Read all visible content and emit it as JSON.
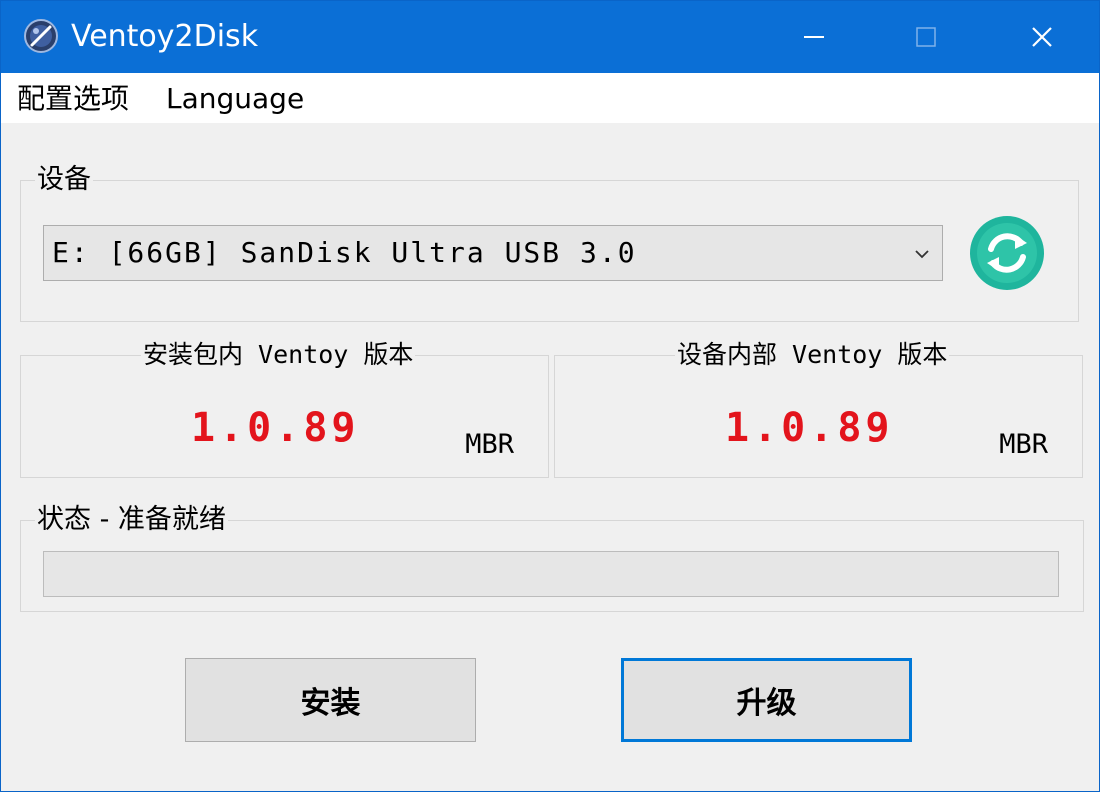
{
  "window": {
    "title": "Ventoy2Disk",
    "accent_color": "#0b6fd6",
    "icons": {
      "app": "ventoy-app-icon",
      "minimize": "minimize-icon",
      "maximize": "maximize-icon",
      "close": "close-icon"
    }
  },
  "menu": {
    "items": [
      {
        "label": "配置选项"
      },
      {
        "label": "Language"
      }
    ]
  },
  "device": {
    "group_label": "设备",
    "selected": "E: [66GB] SanDisk Ultra USB 3.0",
    "dropdown_icon": "chevron-down-icon",
    "refresh_icon": "refresh-icon",
    "refresh_color": "#1fb59d"
  },
  "package_version": {
    "label": "安装包内 Ventoy 版本",
    "version": "1.0.89",
    "partition_style": "MBR"
  },
  "device_version": {
    "label": "设备内部 Ventoy 版本",
    "version": "1.0.89",
    "partition_style": "MBR"
  },
  "version_color": "#e3141c",
  "status": {
    "label": "状态 - 准备就绪",
    "progress": 0
  },
  "buttons": {
    "install": "安装",
    "update": "升级"
  }
}
